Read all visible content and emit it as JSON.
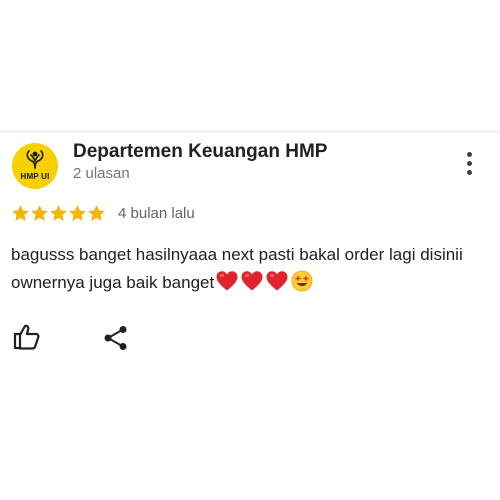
{
  "review": {
    "avatar_text": "HMP UI",
    "author": "Departemen Keuangan HMP",
    "review_count": "2 ulasan",
    "rating": 5,
    "rating_max": 5,
    "time": "4 bulan lalu",
    "text": "bagusss banget hasilnyaaa next pasti bakal order lagi disinii ownernya juga baik banget",
    "emojis": [
      "red-heart",
      "red-heart",
      "red-heart",
      "star-struck-face"
    ]
  },
  "actions": {
    "like_icon": "thumbs-up-icon",
    "share_icon": "share-icon",
    "more_icon": "more-vertical-icon"
  },
  "colors": {
    "star": "#f4b400",
    "avatar_bg": "#f7d000",
    "heart": "#e0242e"
  }
}
